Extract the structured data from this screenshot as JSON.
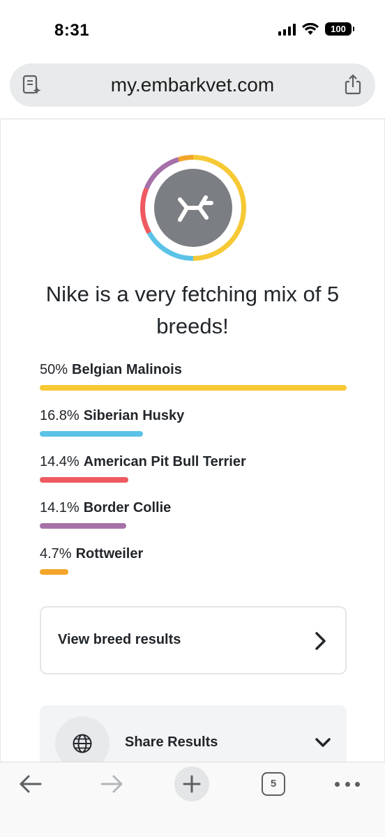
{
  "status_bar": {
    "time": "8:31",
    "battery_level": "100",
    "icons": [
      "signal-icon",
      "wifi-icon",
      "battery-icon"
    ]
  },
  "browser": {
    "url": "my.embarkvet.com",
    "open_tabs": "5",
    "icons": [
      "reader-mode-icon",
      "share-icon",
      "back-arrow-icon",
      "forward-arrow-icon",
      "plus-icon",
      "tabs-icon",
      "more-dots-icon"
    ]
  },
  "results": {
    "headline": "Nike is a very fetching mix of 5 breeds!",
    "logo_icon": "embark-logo-icon",
    "breeds": [
      {
        "percent": "50%",
        "name": "Belgian Malinois",
        "value": 50,
        "color": "#f6c935"
      },
      {
        "percent": "16.8%",
        "name": "Siberian Husky",
        "value": 16.8,
        "color": "#5bc2e7"
      },
      {
        "percent": "14.4%",
        "name": "American Pit Bull Terrier",
        "value": 14.4,
        "color": "#ee5a5f"
      },
      {
        "percent": "14.1%",
        "name": "Border Collie",
        "value": 14.1,
        "color": "#a571a8"
      },
      {
        "percent": "4.7%",
        "name": "Rottweiler",
        "value": 4.7,
        "color": "#f3a52a"
      }
    ],
    "view_breed_results_label": "View breed results",
    "share_results_label": "Share Results"
  }
}
